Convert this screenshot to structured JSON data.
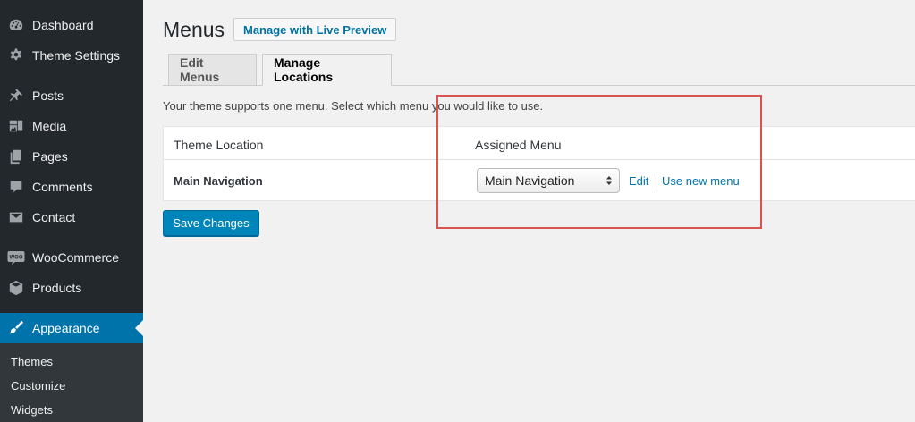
{
  "sidebar": {
    "items": [
      {
        "label": "Dashboard",
        "icon": "dashboard-icon"
      },
      {
        "label": "Theme Settings",
        "icon": "gear-icon"
      },
      {
        "label": "Posts",
        "icon": "pin-icon"
      },
      {
        "label": "Media",
        "icon": "media-icon"
      },
      {
        "label": "Pages",
        "icon": "pages-icon"
      },
      {
        "label": "Comments",
        "icon": "comment-icon"
      },
      {
        "label": "Contact",
        "icon": "envelope-icon"
      },
      {
        "label": "WooCommerce",
        "icon": "woocommerce-icon"
      },
      {
        "label": "Products",
        "icon": "box-icon"
      },
      {
        "label": "Appearance",
        "icon": "brush-icon"
      }
    ],
    "active": "Appearance",
    "submenu": [
      "Themes",
      "Customize",
      "Widgets"
    ]
  },
  "header": {
    "title": "Menus",
    "live_preview_label": "Manage with Live Preview"
  },
  "tabs": [
    {
      "label": "Edit Menus",
      "active": false
    },
    {
      "label": "Manage Locations",
      "active": true
    }
  ],
  "main": {
    "intro": "Your theme supports one menu. Select which menu you would like to use.",
    "table": {
      "headers": [
        "Theme Location",
        "Assigned Menu"
      ],
      "rows": [
        {
          "location": "Main Navigation",
          "selected_menu": "Main Navigation",
          "edit_label": "Edit",
          "new_label": "Use new menu"
        }
      ]
    },
    "save_label": "Save Changes"
  },
  "colors": {
    "sidebar_bg": "#23282d",
    "active_bg": "#0073aa",
    "link": "#0073aa",
    "button_primary": "#0085ba",
    "annotation": "#d9534f"
  }
}
